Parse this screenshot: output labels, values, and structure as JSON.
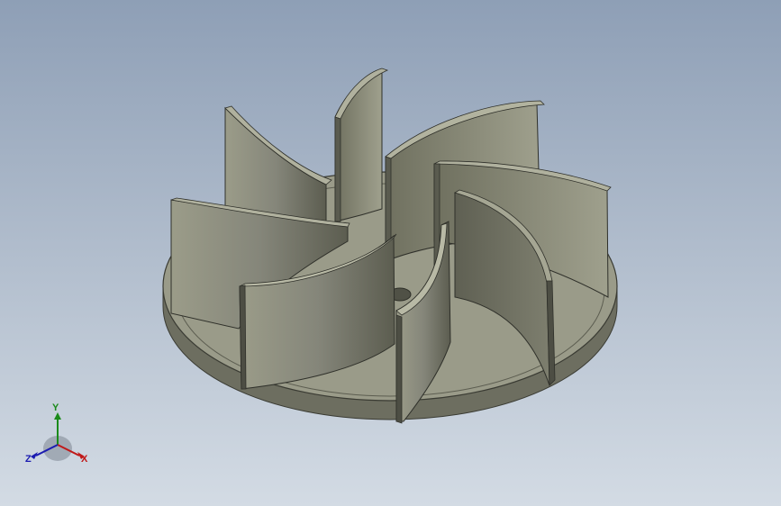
{
  "viewport": {
    "background_top": "#8e9fb6",
    "background_bottom": "#d3dbe4",
    "model": {
      "name": "impeller",
      "blade_count": 8,
      "color": "#8a8a78"
    }
  },
  "triad": {
    "x_label": "X",
    "y_label": "Y",
    "z_label": "Z",
    "x_color": "#c01818",
    "y_color": "#1a8a1a",
    "z_color": "#1a1ab0"
  }
}
